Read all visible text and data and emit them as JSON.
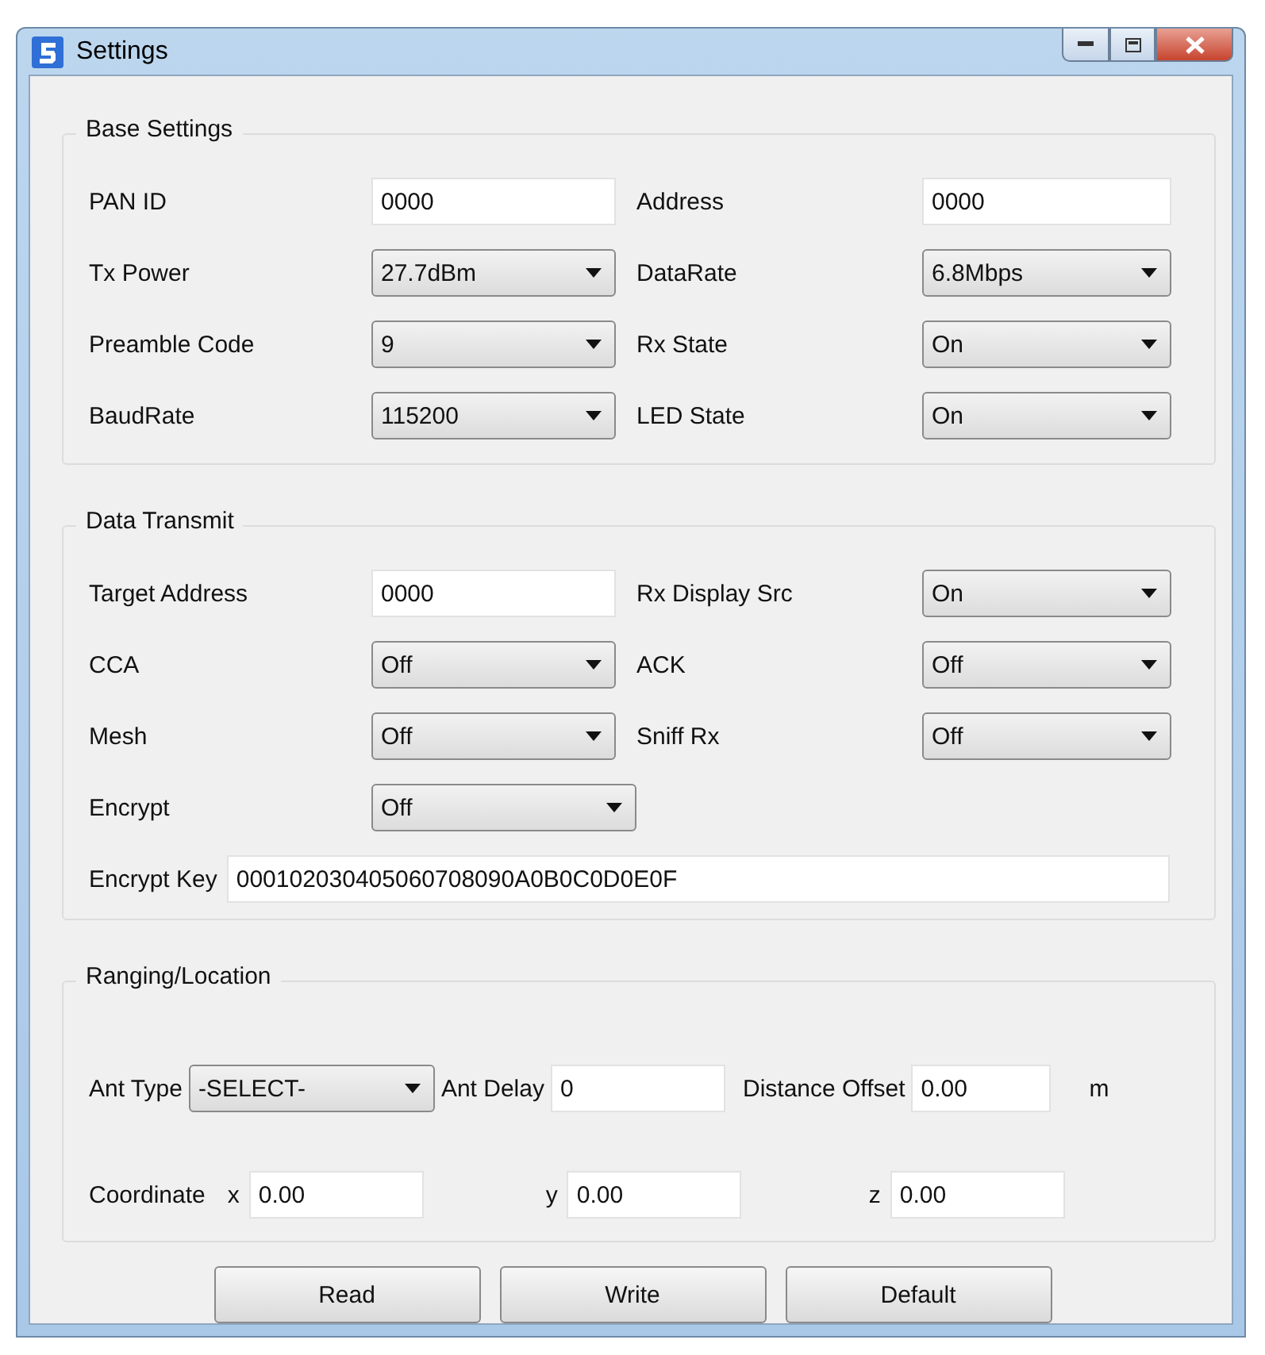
{
  "window": {
    "title": "Settings"
  },
  "base_settings": {
    "title": "Base Settings",
    "fields": [
      {
        "label": "PAN ID",
        "kind": "text",
        "value": "0000"
      },
      {
        "label": "Address",
        "kind": "text",
        "value": "0000"
      },
      {
        "label": "Tx Power",
        "kind": "select",
        "value": "27.7dBm"
      },
      {
        "label": "DataRate",
        "kind": "select",
        "value": "6.8Mbps"
      },
      {
        "label": "Preamble Code",
        "kind": "select",
        "value": "9"
      },
      {
        "label": "Rx State",
        "kind": "select",
        "value": "On"
      },
      {
        "label": "BaudRate",
        "kind": "select",
        "value": "115200"
      },
      {
        "label": "LED State",
        "kind": "select",
        "value": "On"
      }
    ]
  },
  "data_transmit": {
    "title": "Data Transmit",
    "fields": [
      {
        "label": "Target Address",
        "kind": "text",
        "value": "0000"
      },
      {
        "label": "Rx Display Src",
        "kind": "select",
        "value": "On"
      },
      {
        "label": "CCA",
        "kind": "select",
        "value": "Off"
      },
      {
        "label": "ACK",
        "kind": "select",
        "value": "Off"
      },
      {
        "label": "Mesh",
        "kind": "select",
        "value": "Off"
      },
      {
        "label": "Sniff Rx",
        "kind": "select",
        "value": "Off"
      },
      {
        "label": "Encrypt",
        "kind": "select",
        "value": "Off"
      }
    ],
    "encrypt_key": {
      "label": "Encrypt Key",
      "value": "000102030405060708090A0B0C0D0E0F"
    }
  },
  "ranging": {
    "title": "Ranging/Location",
    "ant_type": {
      "label": "Ant Type",
      "value": "-SELECT-"
    },
    "ant_delay": {
      "label": "Ant Delay",
      "value": "0"
    },
    "distance_offset": {
      "label": "Distance Offset",
      "value": "0.00",
      "unit": "m"
    },
    "coordinate": {
      "label": "Coordinate",
      "axes": [
        {
          "axis": "x",
          "value": "0.00"
        },
        {
          "axis": "y",
          "value": "0.00"
        },
        {
          "axis": "z",
          "value": "0.00"
        }
      ]
    }
  },
  "buttons": [
    "Read",
    "Write",
    "Default"
  ]
}
